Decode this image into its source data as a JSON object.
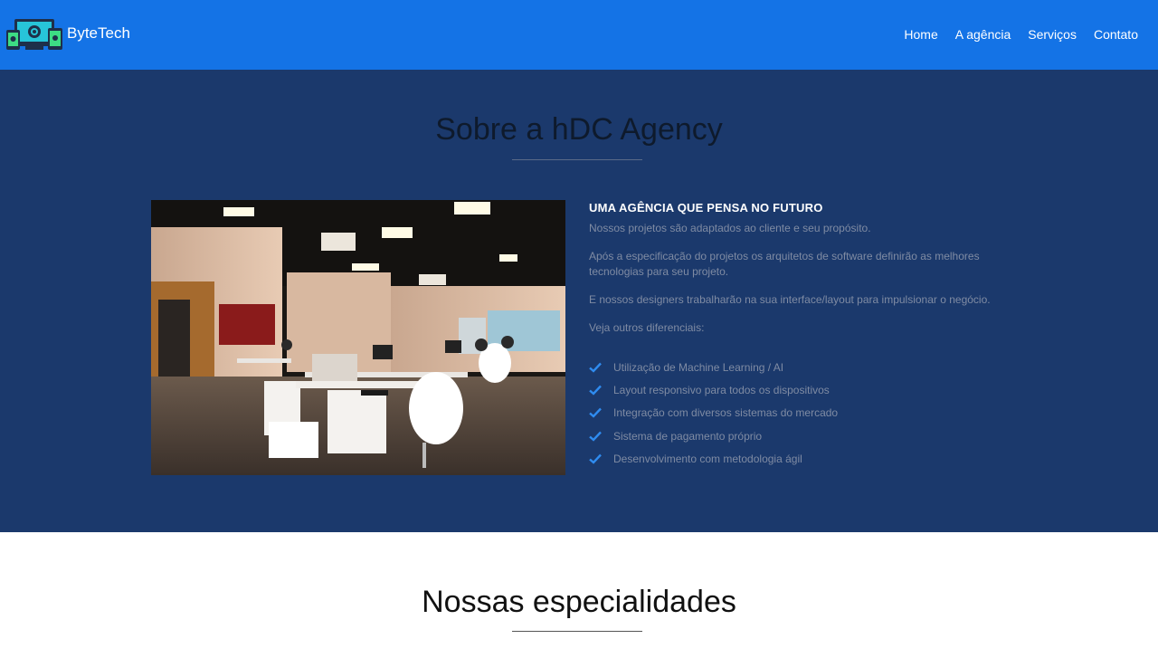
{
  "navbar": {
    "brand": "ByteTech",
    "logo_icon": "devices-logo-icon",
    "links": [
      "Home",
      "A agência",
      "Serviços",
      "Contato"
    ],
    "color": "#1473e6"
  },
  "about": {
    "title": "Sobre a hDC Agency",
    "heading": "UMA AGÊNCIA QUE PENSA NO FUTURO",
    "paragraphs": [
      "Nossos projetos são adaptados ao cliente e seu propósito.",
      "Após a especificação do projetos os arquitetos de software definirão as melhores tecnologias para seu projeto.",
      "E nossos designers trabalharão na sua interface/layout para impulsionar o negócio.",
      "Veja outros diferenciais:"
    ],
    "features": [
      "Utilização de Machine Learning / AI",
      "Layout responsivo para todos os dispositivos",
      "Integração com diversos sistemas do mercado",
      "Sistema de pagamento próprio",
      "Desenvolvimento com metodologia ágil"
    ],
    "check_icon": "check-icon",
    "background": "#1b396c",
    "accent": "#2f8cf0"
  },
  "specialties": {
    "title": "Nossas especialidades"
  }
}
